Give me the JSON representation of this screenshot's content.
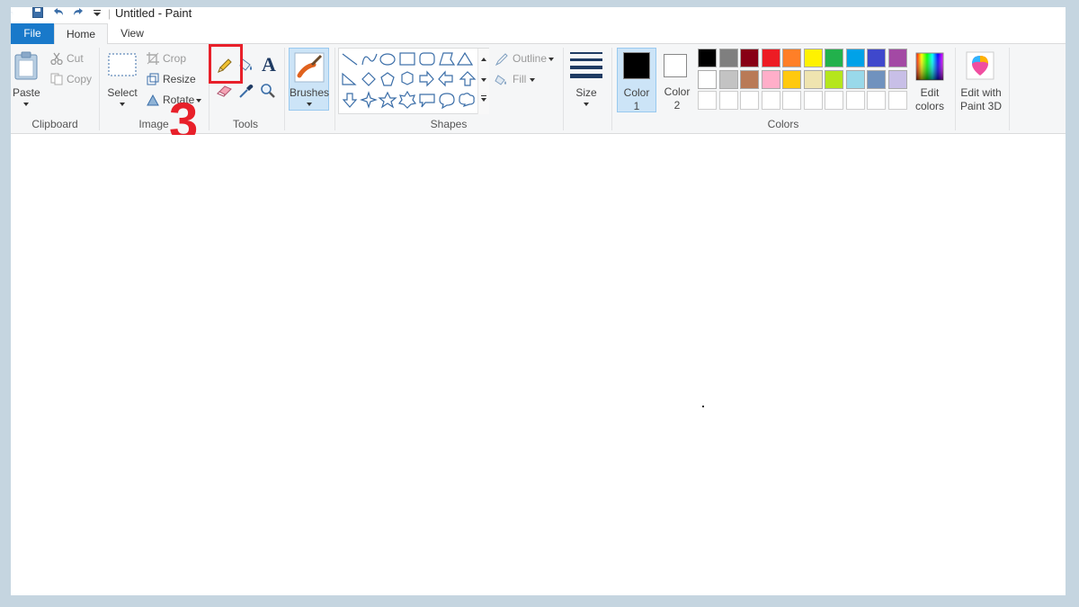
{
  "window": {
    "title": "Untitled - Paint"
  },
  "tabs": {
    "file": "File",
    "home": "Home",
    "view": "View"
  },
  "clipboard": {
    "paste": "Paste",
    "cut": "Cut",
    "copy": "Copy",
    "group": "Clipboard"
  },
  "image": {
    "select": "Select",
    "crop": "Crop",
    "resize": "Resize",
    "rotate": "Rotate",
    "group": "Image"
  },
  "tools": {
    "group": "Tools",
    "text_glyph": "A"
  },
  "brushes": {
    "label": "Brushes"
  },
  "shapes": {
    "group": "Shapes",
    "outline": "Outline",
    "fill": "Fill"
  },
  "size": {
    "label": "Size"
  },
  "colors": {
    "group": "Colors",
    "color1_label": "Color",
    "color1_num": "1",
    "color2_label": "Color",
    "color2_num": "2",
    "edit_l1": "Edit",
    "edit_l2": "colors",
    "color1_value": "#000000",
    "color2_value": "#ffffff",
    "palette_row1": [
      "#000000",
      "#7f7f7f",
      "#880015",
      "#ed1c24",
      "#ff7f27",
      "#fff200",
      "#22b14c",
      "#00a2e8",
      "#3f48cc",
      "#a349a4"
    ],
    "palette_row2": [
      "#ffffff",
      "#c3c3c3",
      "#b97a57",
      "#ffaec9",
      "#ffc90e",
      "#efe4b0",
      "#b5e61d",
      "#99d9ea",
      "#7092be",
      "#c8bfe7"
    ],
    "palette_row3": [
      "#ffffff",
      "#ffffff",
      "#ffffff",
      "#ffffff",
      "#ffffff",
      "#ffffff",
      "#ffffff",
      "#ffffff",
      "#ffffff",
      "#ffffff"
    ]
  },
  "paint3d": {
    "l1": "Edit with",
    "l2": "Paint 3D"
  },
  "annotation": {
    "step": "3"
  }
}
